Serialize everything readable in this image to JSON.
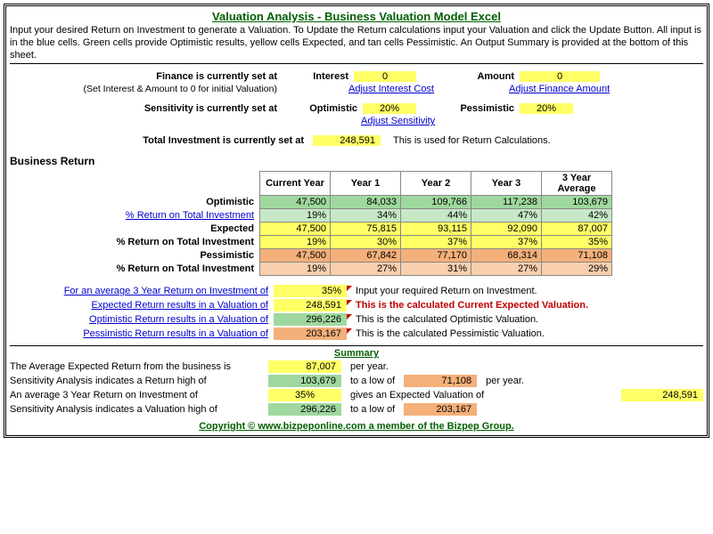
{
  "title": "Valuation Analysis - Business Valuation Model Excel",
  "instructions": "Input your desired Return on Investment to generate a Valuation. To Update the Return calculations input your Valuation and click the Update Button. All input is in the blue cells. Green cells provide Optimistic results, yellow cells Expected, and tan cells Pessimistic. An Output Summary is provided at the bottom of this sheet.",
  "finance": {
    "set_at": "Finance is currently set at",
    "hint": "(Set Interest & Amount to 0 for initial Valuation)",
    "interest_label": "Interest",
    "interest_value": "0",
    "adjust_interest": "Adjust Interest Cost",
    "amount_label": "Amount",
    "amount_value": "0",
    "adjust_amount": "Adjust Finance Amount"
  },
  "sensitivity": {
    "set_at": "Sensitivity is currently set at",
    "opt_label": "Optimistic",
    "opt_value": "20%",
    "pes_label": "Pessimistic",
    "pes_value": "20%",
    "adjust": "Adjust Sensitivity"
  },
  "investment": {
    "set_at": "Total Investment is currently set at",
    "value": "248,591",
    "note": "This is used for Return Calculations."
  },
  "returns": {
    "section": "Business Return",
    "headers": [
      "Current Year",
      "Year 1",
      "Year 2",
      "Year 3",
      "3 Year Average"
    ],
    "rows": [
      {
        "label": "Optimistic",
        "link": false,
        "cls": "green",
        "v": [
          "47,500",
          "84,033",
          "109,766",
          "117,238",
          "103,679"
        ]
      },
      {
        "label": "% Return on Total Investment",
        "link": true,
        "cls": "ltgreen",
        "v": [
          "19%",
          "34%",
          "44%",
          "47%",
          "42%"
        ]
      },
      {
        "label": "Expected",
        "link": false,
        "cls": "yellow",
        "v": [
          "47,500",
          "75,815",
          "93,115",
          "92,090",
          "87,007"
        ]
      },
      {
        "label": "% Return on Total Investment",
        "link": false,
        "cls": "yellow",
        "v": [
          "19%",
          "30%",
          "37%",
          "37%",
          "35%"
        ]
      },
      {
        "label": "Pessimistic",
        "link": false,
        "cls": "tan",
        "v": [
          "47,500",
          "67,842",
          "77,170",
          "68,314",
          "71,108"
        ]
      },
      {
        "label": "% Return on Total Investment",
        "link": false,
        "cls": "lttan",
        "v": [
          "19%",
          "27%",
          "31%",
          "27%",
          "29%"
        ]
      }
    ]
  },
  "valuation": {
    "lines": [
      {
        "label": "For an average 3 Year Return on Investment of",
        "value": "35%",
        "cls": "yellow",
        "note": "Input your required Return on Investment.",
        "red": false
      },
      {
        "label": "Expected Return results in a Valuation of",
        "value": "248,591",
        "cls": "yellow",
        "note": "This is the calculated Current Expected Valuation.",
        "red": true
      },
      {
        "label": "Optimistic Return results in a Valuation of",
        "value": "296,226",
        "cls": "green",
        "note": "This is the calculated Optimistic Valuation.",
        "red": false
      },
      {
        "label": "Pessimistic Return results in a Valuation of",
        "value": "203,167",
        "cls": "tan",
        "note": "This is the calculated Pessimistic Valuation.",
        "red": false
      }
    ]
  },
  "summary": {
    "header": "Summary",
    "l1a": "The Average Expected Return from the business is",
    "l1v": "87,007",
    "l1b": "per year.",
    "l2a": "Sensitivity Analysis indicates a Return high of",
    "l2v1": "103,679",
    "l2b": "to a low of",
    "l2v2": "71,108",
    "l2c": "per year.",
    "l3a": "An average 3 Year Return on Investment of",
    "l3v1": "35%",
    "l3b": "gives an Expected Valuation of",
    "l3v2": "248,591",
    "l4a": "Sensitivity Analysis indicates a Valuation high of",
    "l4v1": "296,226",
    "l4b": "to a low of",
    "l4v2": "203,167"
  },
  "copyright": "Copyright © www.bizpeponline.com a member of the Bizpep Group."
}
